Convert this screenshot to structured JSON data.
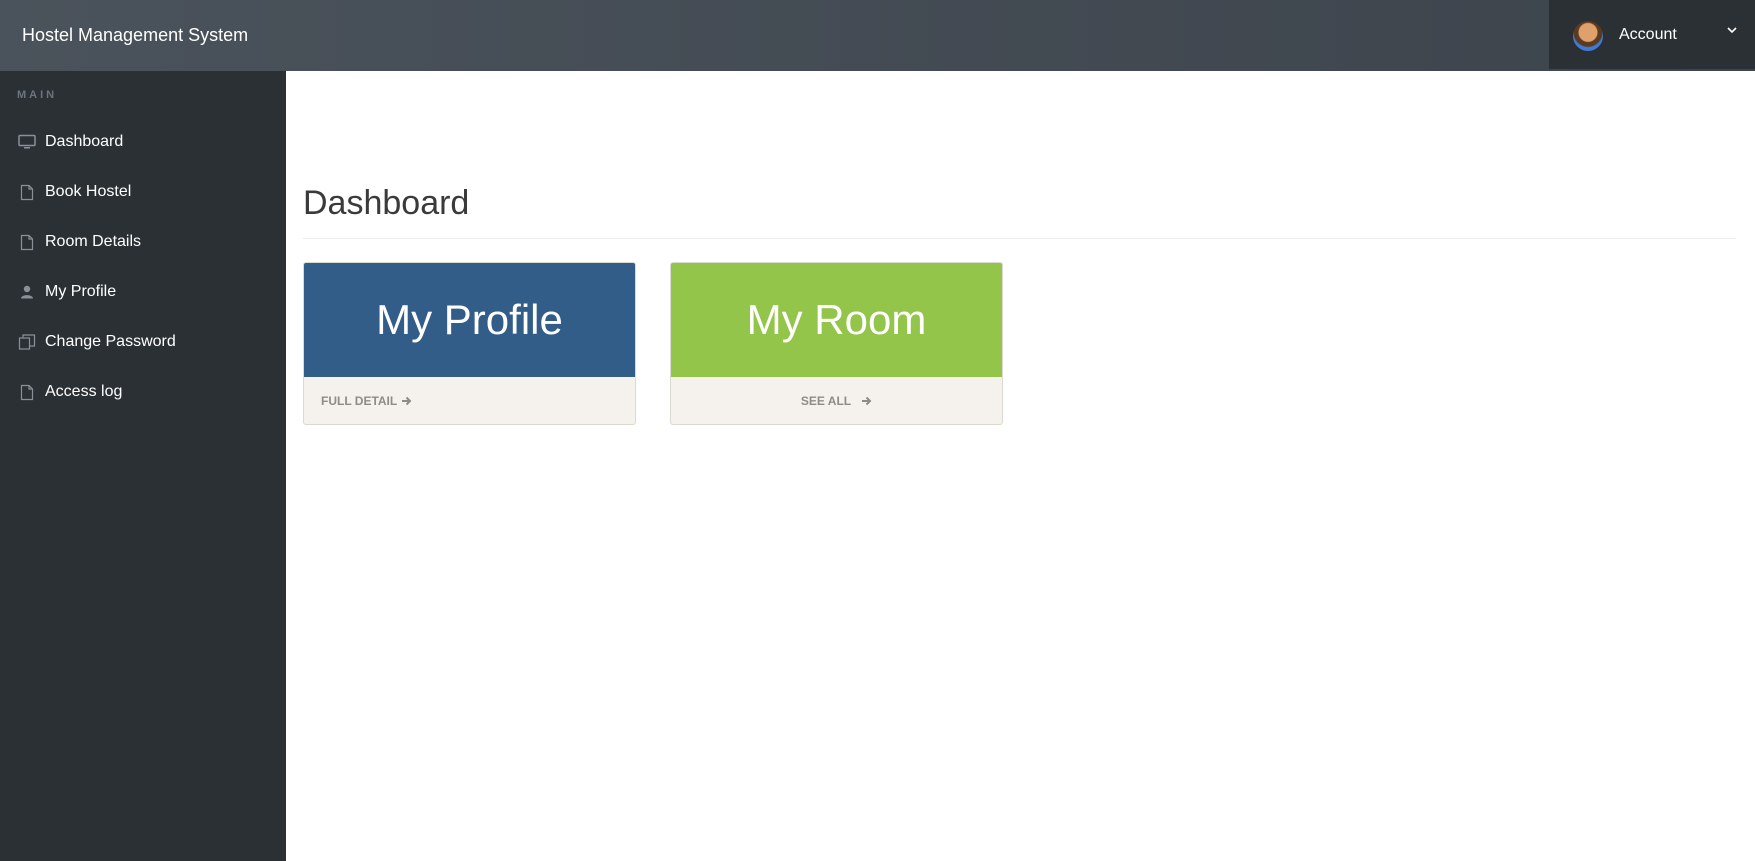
{
  "app": {
    "title": "Hostel Management System"
  },
  "account": {
    "label": "Account"
  },
  "sidebar": {
    "section": "MAIN",
    "items": [
      {
        "label": "Dashboard",
        "icon": "desktop-icon"
      },
      {
        "label": "Book Hostel",
        "icon": "file-icon"
      },
      {
        "label": "Room Details",
        "icon": "file-icon"
      },
      {
        "label": "My Profile",
        "icon": "user-icon"
      },
      {
        "label": "Change Password",
        "icon": "files-icon"
      },
      {
        "label": "Access log",
        "icon": "file-icon"
      }
    ]
  },
  "main": {
    "title": "Dashboard",
    "cards": [
      {
        "title": "My Profile",
        "link": "FULL DETAIL",
        "color": "#325d88"
      },
      {
        "title": "My Room",
        "link": "SEE ALL",
        "color": "#93c54b"
      }
    ]
  }
}
